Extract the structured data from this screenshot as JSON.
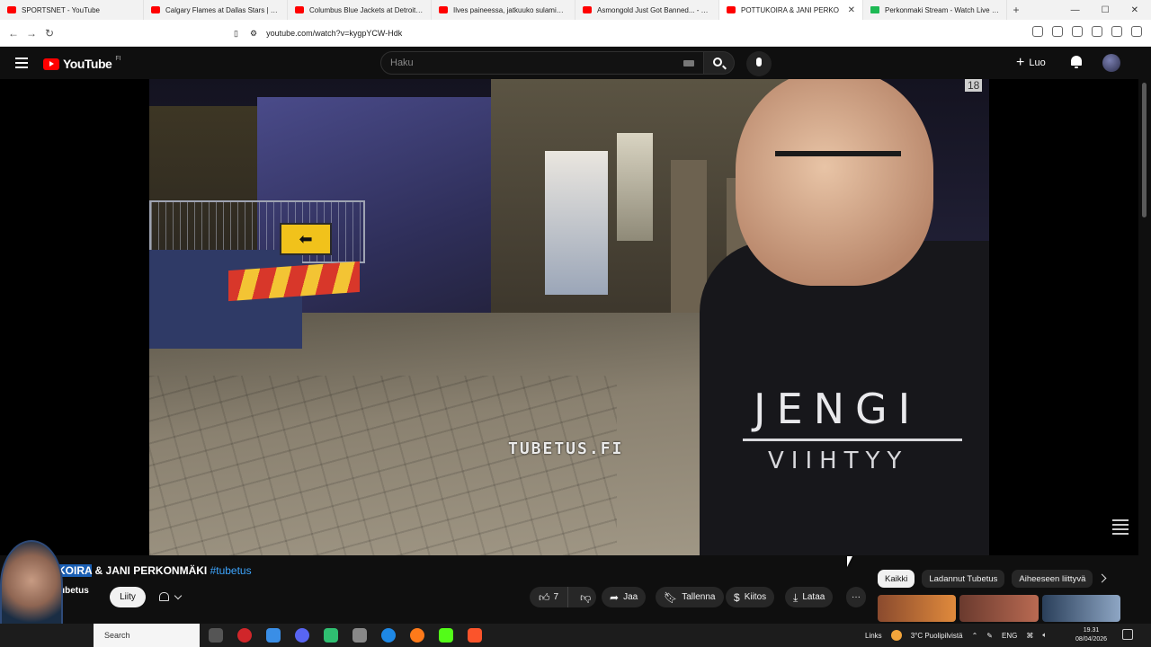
{
  "browser": {
    "tabs": [
      {
        "title": "SPORTSNET - YouTube",
        "favicon": "youtube-icon"
      },
      {
        "title": "Calgary Flames at Dallas Stars | FULL",
        "favicon": "youtube-icon"
      },
      {
        "title": "Columbus Blue Jackets at Detroit Re",
        "favicon": "youtube-icon"
      },
      {
        "title": "Ilves paineessa, jatkuuko sulaminen",
        "favicon": "youtube-icon"
      },
      {
        "title": "Asmongold Just Got Banned... - You",
        "favicon": "youtube-icon"
      },
      {
        "title": "POTTUKOIRA & JANI PERKO",
        "favicon": "youtube-icon",
        "active": true
      },
      {
        "title": "Perkonmaki Stream - Watch Live on",
        "favicon": "kick-icon"
      }
    ],
    "new_tab": "+",
    "url": "youtube.com/watch?v=kygpYCW-Hdk"
  },
  "youtube": {
    "logo_text": "YouTube",
    "region": "FI",
    "search_placeholder": "Haku",
    "create_label": "Luo"
  },
  "video": {
    "watermark": "TUBETUS.FI",
    "hoodie_line1": "JENGI",
    "hoodie_line2": "VIIHTYY",
    "corner_number": "18"
  },
  "info": {
    "title_highlight": "TUKOIRA",
    "title_rest": " & JANI PERKONMÄKI ",
    "hashtag": "#tubetus",
    "channel": "ubetus",
    "join_label": "Liity",
    "like_count": "7",
    "share_label": "Jaa",
    "save_label": "Tallenna",
    "thanks_label": "Kiitos",
    "download_label": "Lataa",
    "more_label": "···"
  },
  "chips": [
    "Kaikki",
    "Ladannut Tubetus",
    "Aiheeseen liittyvä"
  ],
  "taskbar": {
    "search_placeholder": "Search",
    "links": "Links",
    "weather": "3°C  Puolipilvistä",
    "lang": "ENG",
    "time": "19.31",
    "date": "08/04/2026"
  }
}
